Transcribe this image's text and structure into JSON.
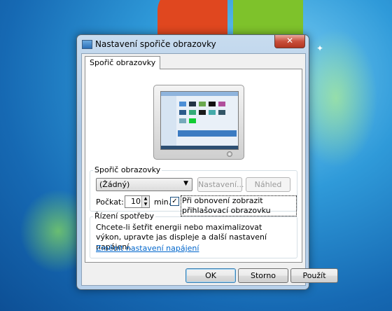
{
  "window": {
    "title": "Nastavení spořiče obrazovky",
    "close": "✕"
  },
  "tab": {
    "label": "Spořič obrazovky"
  },
  "screensaver": {
    "group_label": "Spořič obrazovky",
    "selected": "(Žádný)",
    "settings_btn": "Nastavení...",
    "preview_btn": "Náhled",
    "wait_label": "Počkat:",
    "wait_value": "10",
    "min_label": "min.",
    "resume_checkbox": "Při obnovení zobrazit přihlašovací obrazovku",
    "resume_checked": true
  },
  "power": {
    "group_label": "Řízení spotřeby",
    "text": "Chcete-li šetřit energii nebo maximalizovat výkon, upravte jas displeje a další nastavení napájení.",
    "link": "Změnit nastavení napájení"
  },
  "buttons": {
    "ok": "OK",
    "cancel": "Storno",
    "apply": "Použít"
  },
  "icons": {
    "dropdown": "chevron-down-icon",
    "spin": "spin-arrows-icon",
    "check": "checkmark-icon"
  }
}
